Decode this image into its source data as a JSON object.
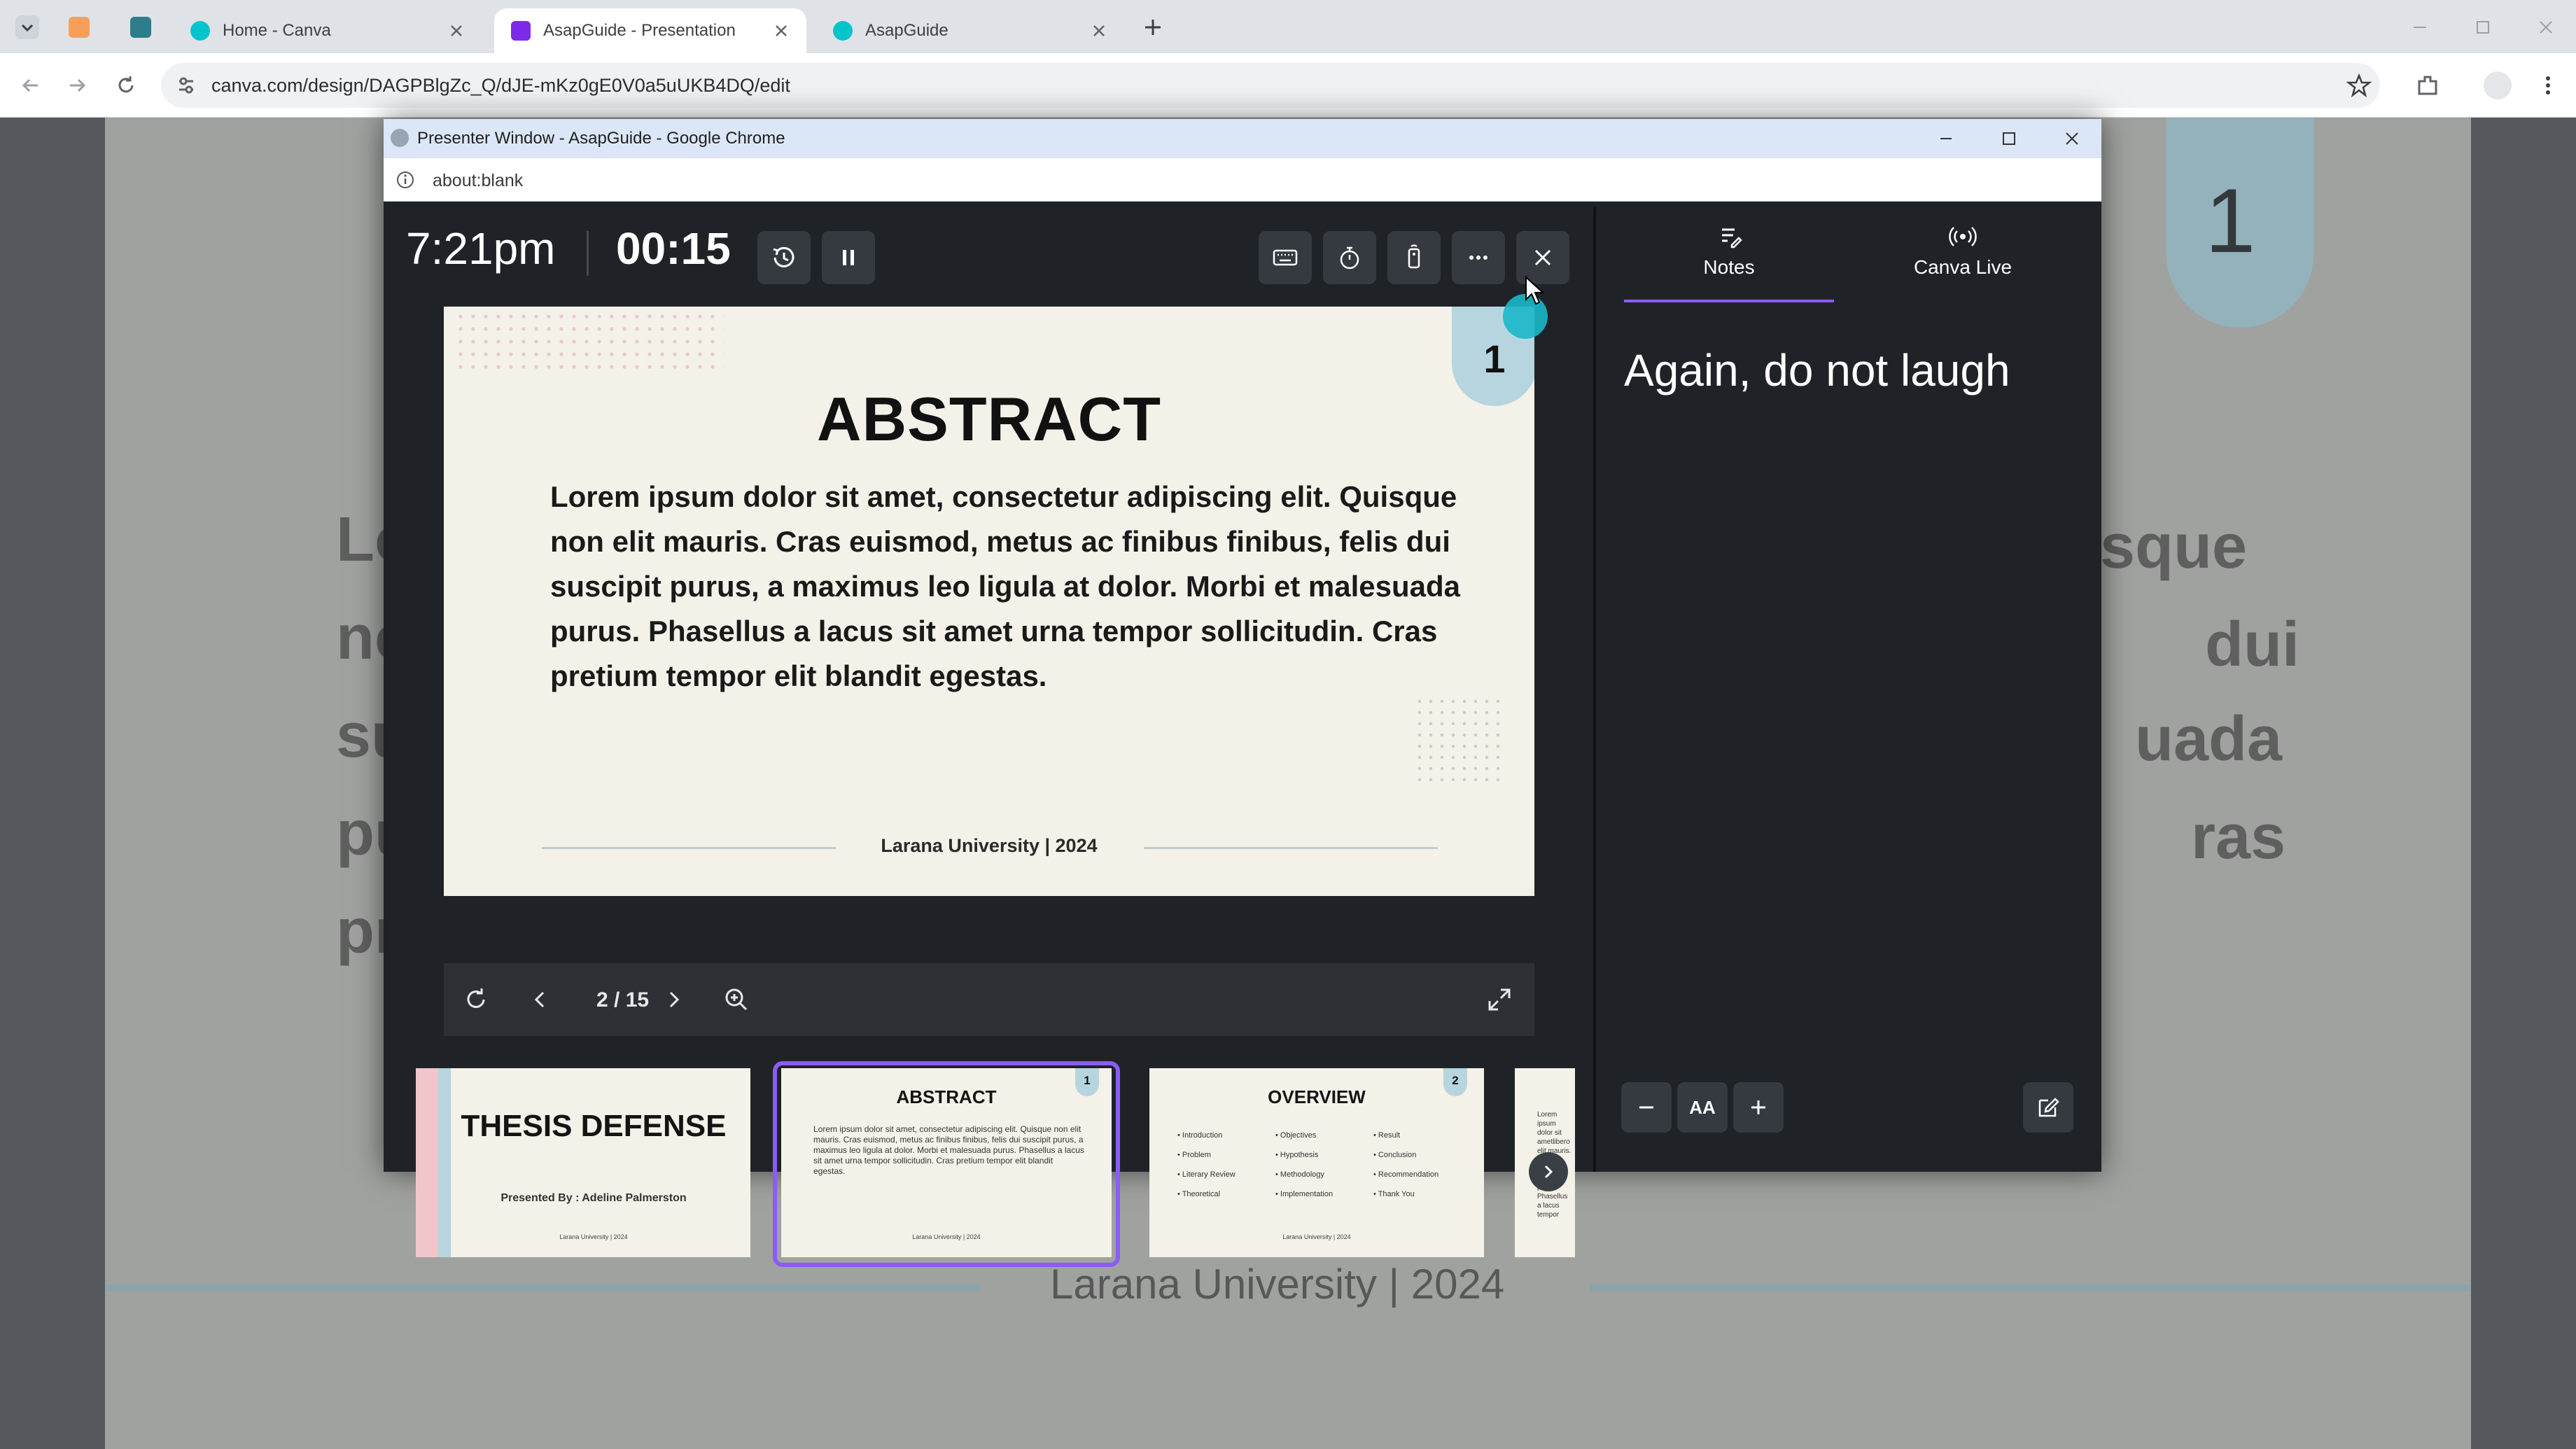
{
  "browser": {
    "tabs": [
      {
        "label": "Home - Canva",
        "favicon_color": "#00c4cc"
      },
      {
        "label": "AsapGuide - Presentation",
        "favicon_color": "#7d2ae8"
      },
      {
        "label": "AsapGuide",
        "favicon_color": "#00c4cc"
      }
    ],
    "url": "canva.com/design/DAGPBlgZc_Q/dJE-mKz0gE0V0a5uUKB4DQ/edit"
  },
  "background_slide": {
    "left_fragments": [
      "Lo",
      "no",
      "su",
      "pu",
      "pr"
    ],
    "right_fragments": [
      "sque",
      "dui",
      "uada",
      "ras"
    ],
    "badge": "1",
    "footer": "Larana University | 2024"
  },
  "presenter_window": {
    "title": "Presenter Window - AsapGuide - Google Chrome",
    "address": "about:blank",
    "clock": "7:21pm",
    "elapsed": "00:15",
    "slide": {
      "title": "ABSTRACT",
      "body": "Lorem ipsum dolor sit amet, consectetur adipiscing elit. Quisque non elit mauris. Cras euismod, metus ac finibus finibus, felis dui suscipit purus, a maximus leo ligula at dolor. Morbi et malesuada purus. Phasellus a lacus sit amet urna tempor sollicitudin. Cras pretium tempor elit blandit egestas.",
      "footer": "Larana University | 2024",
      "badge": "1"
    },
    "page_indicator": "2 / 15",
    "thumbnails": [
      {
        "title": "THESIS DEFENSE",
        "subtitle": "Presented By : Adeline Palmerston",
        "footer": "Larana University | 2024"
      },
      {
        "title": "ABSTRACT",
        "badge": "1",
        "body": "Lorem ipsum dolor sit amet, consectetur adipiscing elit. Quisque non elit mauris. Cras euismod, metus ac finibus finibus, felis dui suscipit purus, a maximus leo ligula at dolor. Morbi et malesuada purus. Phasellus a lacus sit amet urna tempor sollicitudin. Cras pretium tempor elit blandit egestas.",
        "footer": "Larana University | 2024"
      },
      {
        "title": "OVERVIEW",
        "badge": "2",
        "col1": [
          "Introduction",
          "Problem",
          "Literary Review",
          "Theoretical"
        ],
        "col2": [
          "Objectives",
          "Hypothesis",
          "Methodology",
          "Implementation"
        ],
        "col3": [
          "Result",
          "Conclusion",
          "Recommendation",
          "Thank You"
        ],
        "footer": "Larana University | 2024"
      },
      {
        "fragments": "Lorem ipsum dolor sit ametlibero elit mauris. Cras euismod, suscipit purus Phasellus a lacus tempor"
      }
    ],
    "notes_tab": "Notes",
    "live_tab": "Canva Live",
    "notes_text": "Again, do not laugh",
    "font_size_label": "AA"
  }
}
